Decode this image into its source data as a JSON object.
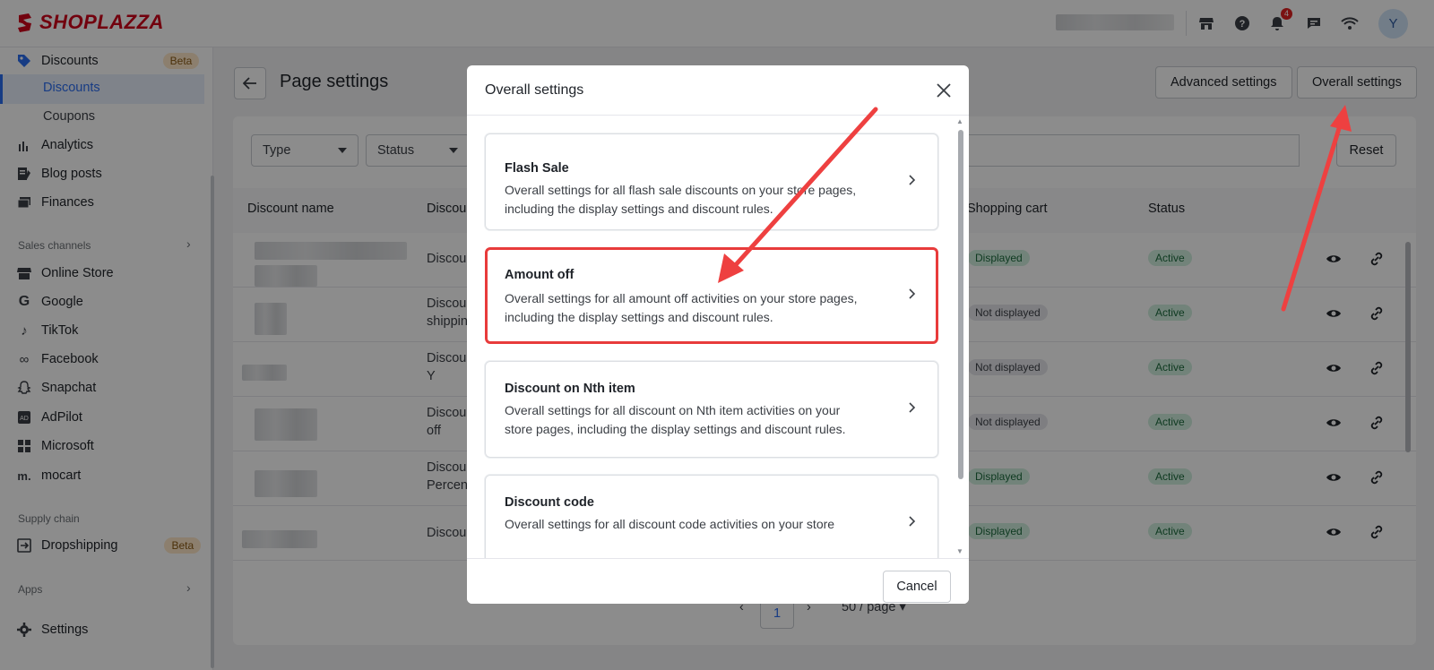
{
  "brand": {
    "name": "SHOPLAZZA",
    "color": "#d0021b"
  },
  "topbar": {
    "notification_count": "4",
    "avatar_initial": "Y"
  },
  "sidebar": {
    "discounts": {
      "label": "Discounts",
      "badge": "Beta"
    },
    "discounts_sub": [
      {
        "label": "Discounts",
        "active": true
      },
      {
        "label": "Coupons",
        "active": false
      }
    ],
    "items": [
      {
        "label": "Analytics",
        "icon": "bar-chart-icon"
      },
      {
        "label": "Blog posts",
        "icon": "blog-icon"
      },
      {
        "label": "Finances",
        "icon": "finances-icon"
      }
    ],
    "sales_channels_label": "Sales channels",
    "channels": [
      {
        "label": "Online Store",
        "icon": "store-icon"
      },
      {
        "label": "Google",
        "icon": "google-icon"
      },
      {
        "label": "TikTok",
        "icon": "tiktok-icon"
      },
      {
        "label": "Facebook",
        "icon": "meta-icon"
      },
      {
        "label": "Snapchat",
        "icon": "snapchat-icon"
      },
      {
        "label": "AdPilot",
        "icon": "adpilot-icon"
      },
      {
        "label": "Microsoft",
        "icon": "microsoft-icon"
      },
      {
        "label": "mocart",
        "icon": "mocart-icon"
      }
    ],
    "supply_chain_label": "Supply chain",
    "dropshipping": {
      "label": "Dropshipping",
      "badge": "Beta"
    },
    "apps_label": "Apps",
    "settings_label": "Settings"
  },
  "page": {
    "title": "Page settings",
    "advanced_settings": "Advanced settings",
    "overall_settings": "Overall settings",
    "filters": {
      "type": "Type",
      "status": "Status",
      "reset": "Reset"
    },
    "columns": {
      "name": "Discount name",
      "type": "Discou",
      "cart": "Shopping cart",
      "status": "Status"
    },
    "rows": [
      {
        "type": "Discou",
        "cart": "Displayed",
        "cart_state": "displayed",
        "status": "Active"
      },
      {
        "type": "Discou\nshippin",
        "cart": "Not displayed",
        "cart_state": "not",
        "status": "Active"
      },
      {
        "type": "Discou\nY",
        "cart": "Not displayed",
        "cart_state": "not",
        "status": "Active"
      },
      {
        "type": "Discou\noff",
        "cart": "Not displayed",
        "cart_state": "not",
        "status": "Active"
      },
      {
        "type": "Discou\nPercent",
        "cart": "Displayed",
        "cart_state": "displayed",
        "status": "Active"
      },
      {
        "type": "Discou",
        "cart": "Displayed",
        "cart_state": "displayed",
        "status": "Active"
      }
    ],
    "pagination": {
      "current": "1",
      "per_page": "50 / page"
    }
  },
  "modal": {
    "title": "Overall settings",
    "options": [
      {
        "title": "Flash Sale",
        "desc": "Overall settings for all flash sale discounts on your store pages, including the display settings and discount rules.",
        "highlighted": false
      },
      {
        "title": "Amount off",
        "desc": "Overall settings for all amount off activities on your store pages, including the display settings and discount rules.",
        "highlighted": true
      },
      {
        "title": "Discount on Nth item",
        "desc": "Overall settings for all discount on Nth item activities on your store pages, including the display settings and discount rules.",
        "highlighted": false
      },
      {
        "title": "Discount code",
        "desc": "Overall settings for all discount code activities on your store",
        "highlighted": false
      }
    ],
    "cancel": "Cancel"
  },
  "annotation_color": "#ee4040"
}
